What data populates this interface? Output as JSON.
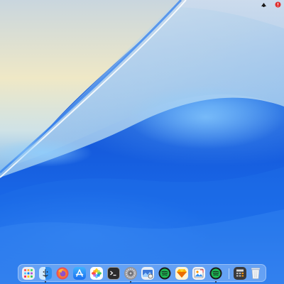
{
  "menubar": {
    "icons": [
      "app-status-icon",
      "notification-badge-icon"
    ],
    "badge_color": "#e03030"
  },
  "dock": {
    "apps": [
      {
        "name": "launchpad",
        "running": false
      },
      {
        "name": "finder",
        "running": true
      },
      {
        "name": "firefox",
        "running": false
      },
      {
        "name": "app-store",
        "running": false
      },
      {
        "name": "photos",
        "running": false
      },
      {
        "name": "terminal",
        "running": false
      },
      {
        "name": "system-settings",
        "running": true
      },
      {
        "name": "preview",
        "running": false
      },
      {
        "name": "spotify",
        "running": false
      },
      {
        "name": "sketch",
        "running": false
      },
      {
        "name": "image-viewer",
        "running": false
      },
      {
        "name": "spotify-alt",
        "running": true
      },
      {
        "name": "calculator",
        "running": false
      },
      {
        "name": "trash",
        "running": false
      }
    ]
  },
  "colors": {
    "wallpaper_blue": "#1456d8",
    "wallpaper_light": "#f2eccd",
    "accent_spotify": "#1db954"
  }
}
